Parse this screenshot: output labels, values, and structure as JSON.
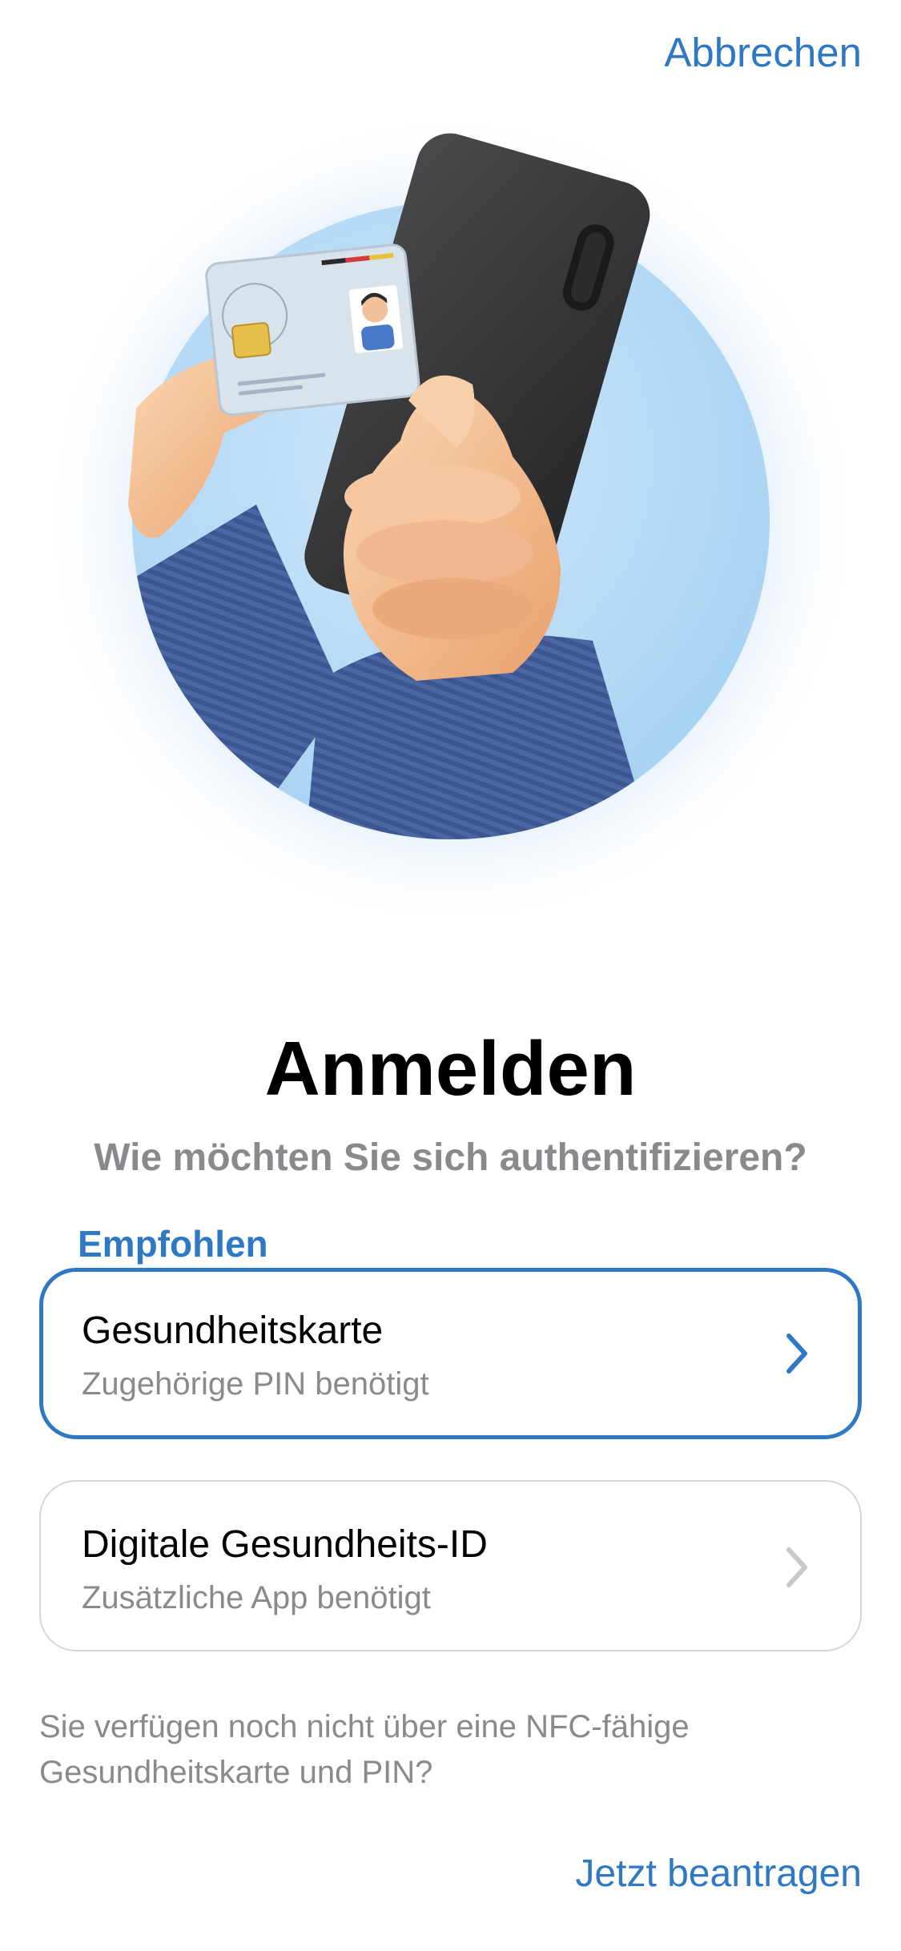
{
  "header": {
    "cancel_label": "Abbrechen"
  },
  "main": {
    "title": "Anmelden",
    "subtitle": "Wie möchten Sie sich authentifizieren?",
    "recommended_label": "Empfohlen",
    "options": [
      {
        "title": "Gesundheitskarte",
        "subtitle": "Zugehörige PIN benötigt",
        "highlighted": true,
        "chevron_icon": "chevron-right-icon"
      },
      {
        "title": "Digitale Gesundheits-ID",
        "subtitle": "Zusätzliche App benötigt",
        "highlighted": false,
        "chevron_icon": "chevron-right-icon"
      }
    ],
    "note": "Sie verfügen noch nicht über eine NFC-fähige Gesundheitskarte und PIN?",
    "apply_label": "Jetzt beantragen"
  },
  "colors": {
    "accent": "#2f78c4",
    "secondary_text": "#8a8a8e",
    "card_border": "#d6d6da",
    "chevron_inactive": "#c7c7cc"
  }
}
